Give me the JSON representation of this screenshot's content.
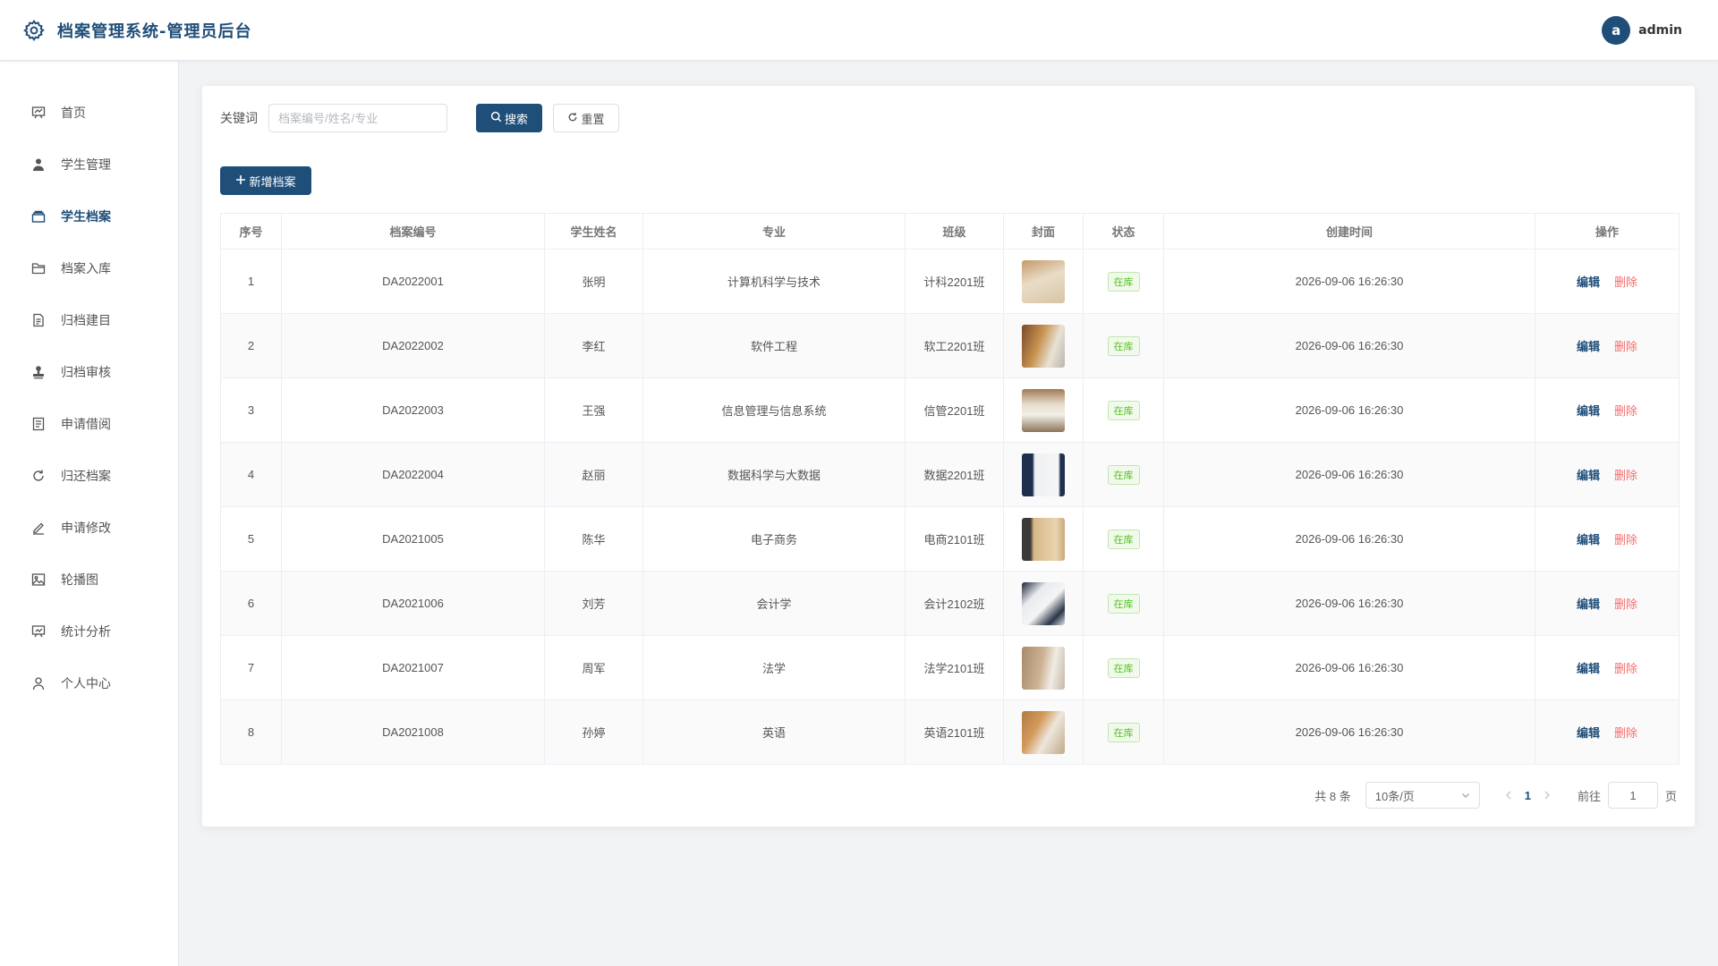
{
  "header": {
    "title": "档案管理系统-管理员后台",
    "avatar_letter": "a",
    "username": "admin"
  },
  "sidebar": {
    "items": [
      {
        "label": "首页",
        "icon": "dashboard-icon",
        "active": false
      },
      {
        "label": "学生管理",
        "icon": "user-icon",
        "active": false
      },
      {
        "label": "学生档案",
        "icon": "archive-box-icon",
        "active": true
      },
      {
        "label": "档案入库",
        "icon": "folder-icon",
        "active": false
      },
      {
        "label": "归档建目",
        "icon": "document-icon",
        "active": false
      },
      {
        "label": "归档审核",
        "icon": "stamp-icon",
        "active": false
      },
      {
        "label": "申请借阅",
        "icon": "form-icon",
        "active": false
      },
      {
        "label": "归还档案",
        "icon": "refresh-icon",
        "active": false
      },
      {
        "label": "申请修改",
        "icon": "edit-pen-icon",
        "active": false
      },
      {
        "label": "轮播图",
        "icon": "picture-icon",
        "active": false
      },
      {
        "label": "统计分析",
        "icon": "presentation-chart-icon",
        "active": false
      },
      {
        "label": "个人中心",
        "icon": "person-outline-icon",
        "active": false
      }
    ]
  },
  "search": {
    "label": "关键词",
    "placeholder": "档案编号/姓名/专业",
    "value": "",
    "search_button": "搜索",
    "reset_button": "重置"
  },
  "toolbar": {
    "add_button": "新增档案"
  },
  "table": {
    "columns": [
      "序号",
      "档案编号",
      "学生姓名",
      "专业",
      "班级",
      "封面",
      "状态",
      "创建时间",
      "操作"
    ],
    "rows": [
      {
        "index": "1",
        "code": "DA2022001",
        "name": "张明",
        "major": "计算机科学与技术",
        "class": "计科2201班",
        "status": "在库",
        "created": "2026-09-06 16:26:30"
      },
      {
        "index": "2",
        "code": "DA2022002",
        "name": "李红",
        "major": "软件工程",
        "class": "软工2201班",
        "status": "在库",
        "created": "2026-09-06 16:26:30"
      },
      {
        "index": "3",
        "code": "DA2022003",
        "name": "王强",
        "major": "信息管理与信息系统",
        "class": "信管2201班",
        "status": "在库",
        "created": "2026-09-06 16:26:30"
      },
      {
        "index": "4",
        "code": "DA2022004",
        "name": "赵丽",
        "major": "数据科学与大数据",
        "class": "数据2201班",
        "status": "在库",
        "created": "2026-09-06 16:26:30"
      },
      {
        "index": "5",
        "code": "DA2021005",
        "name": "陈华",
        "major": "电子商务",
        "class": "电商2101班",
        "status": "在库",
        "created": "2026-09-06 16:26:30"
      },
      {
        "index": "6",
        "code": "DA2021006",
        "name": "刘芳",
        "major": "会计学",
        "class": "会计2102班",
        "status": "在库",
        "created": "2026-09-06 16:26:30"
      },
      {
        "index": "7",
        "code": "DA2021007",
        "name": "周军",
        "major": "法学",
        "class": "法学2101班",
        "status": "在库",
        "created": "2026-09-06 16:26:30"
      },
      {
        "index": "8",
        "code": "DA2021008",
        "name": "孙婷",
        "major": "英语",
        "class": "英语2101班",
        "status": "在库",
        "created": "2026-09-06 16:26:30"
      }
    ],
    "edit_label": "编辑",
    "delete_label": "删除"
  },
  "pagination": {
    "total_text": "共 8 条",
    "page_size": "10条/页",
    "current_page": "1",
    "goto_label": "前往",
    "goto_value": "1",
    "page_suffix": "页"
  },
  "colors": {
    "primary": "#1f4e79",
    "danger": "#f56c6c",
    "success": "#52c41a"
  }
}
